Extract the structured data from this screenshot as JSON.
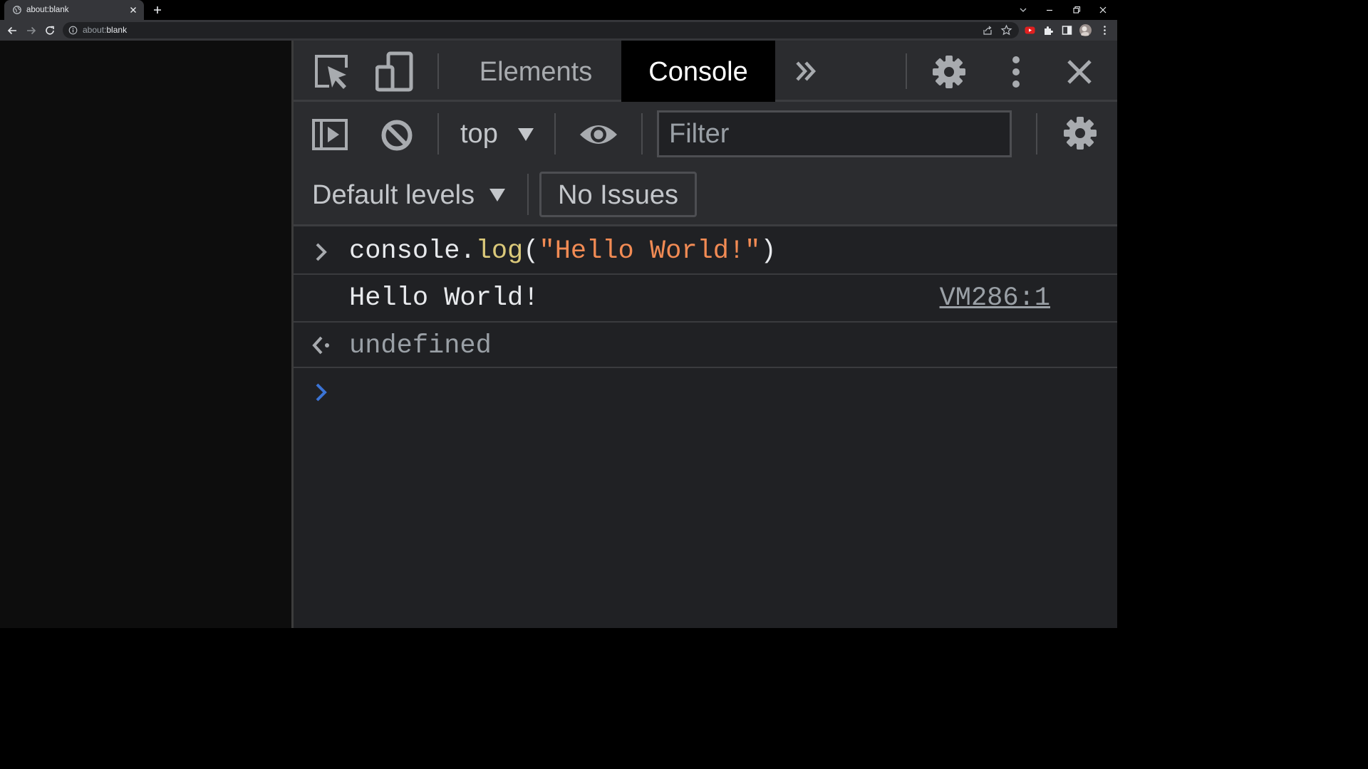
{
  "browser": {
    "tab_title": "about:blank",
    "url_prefix": "about:",
    "url_rest": "blank"
  },
  "devtools": {
    "tabs": [
      "Elements",
      "Console"
    ],
    "active_tab": "Console",
    "context": "top",
    "filter_placeholder": "Filter",
    "levels_label": "Default levels",
    "issues_label": "No Issues"
  },
  "console": {
    "input_command": {
      "part1": "console.",
      "part2": "log",
      "part3": "(",
      "part4": "\"Hello World!\"",
      "part5": ")"
    },
    "log_output": "Hello World!",
    "log_source": "VM286:1",
    "return_value": "undefined"
  },
  "colors": {
    "accent_prompt": "#3b74d6",
    "string": "#f28b54",
    "method": "#dbc97a",
    "active_tab_bg": "#000000"
  }
}
